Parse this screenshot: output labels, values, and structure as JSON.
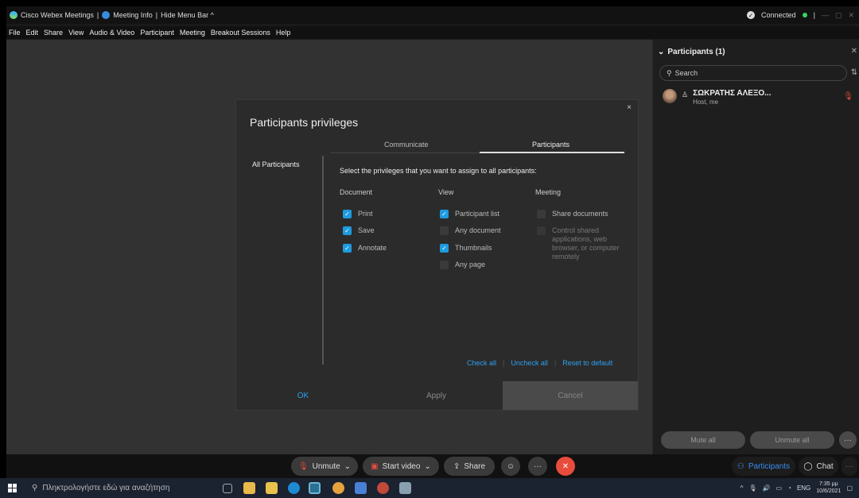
{
  "titlebar": {
    "app": "Cisco Webex Meetings",
    "meeting_info": "Meeting Info",
    "hide_menu": "Hide Menu Bar ^",
    "sep": "|",
    "connected": "Connected",
    "window_min": "—",
    "window_max": "▢",
    "window_close": "✕"
  },
  "menubar": [
    "File",
    "Edit",
    "Share",
    "View",
    "Audio & Video",
    "Participant",
    "Meeting",
    "Breakout Sessions",
    "Help"
  ],
  "dialog": {
    "title": "Participants privileges",
    "close": "×",
    "tabs": [
      "Communicate",
      "Participants"
    ],
    "sidebar_item": "All Participants",
    "instruction": "Select the privileges that you want to assign to all participants:",
    "columns": {
      "document": {
        "header": "Document",
        "items": [
          {
            "label": "Print",
            "checked": true
          },
          {
            "label": "Save",
            "checked": true
          },
          {
            "label": "Annotate",
            "checked": true
          }
        ]
      },
      "view": {
        "header": "View",
        "items": [
          {
            "label": "Participant list",
            "checked": true
          },
          {
            "label": "Any document",
            "checked": false
          },
          {
            "label": "Thumbnails",
            "checked": true
          },
          {
            "label": "Any page",
            "checked": false
          }
        ]
      },
      "meeting": {
        "header": "Meeting",
        "items": [
          {
            "label": "Share documents",
            "checked": false
          },
          {
            "label": "Control shared applications, web browser, or computer remotely",
            "checked": false
          }
        ]
      }
    },
    "links": {
      "check_all": "Check all",
      "uncheck_all": "Uncheck all",
      "reset": "Reset to default"
    },
    "buttons": {
      "ok": "OK",
      "apply": "Apply",
      "cancel": "Cancel"
    }
  },
  "panel": {
    "header": "Participants (1)",
    "search_placeholder": "Search",
    "participant": {
      "name": "ΣΩΚΡΑΤΗΣ ΑΛΕΞΟ...",
      "role": "Host, me"
    },
    "mute_all": "Mute all",
    "unmute_all": "Unmute all",
    "more": "···"
  },
  "controls": {
    "unmute": "Unmute",
    "start_video": "Start video",
    "share": "Share",
    "more": "···",
    "participants": "Participants",
    "chat": "Chat",
    "end": "✕"
  },
  "taskbar": {
    "search": "Πληκτρολογήστε εδώ για αναζήτηση",
    "lang": "ENG",
    "time": "7:35 μμ",
    "date": "10/6/2021"
  },
  "colors": {
    "accent": "#1e9be0",
    "link": "#2ea0f0",
    "end_call": "#e84c3d",
    "connected": "#3ccf62"
  }
}
